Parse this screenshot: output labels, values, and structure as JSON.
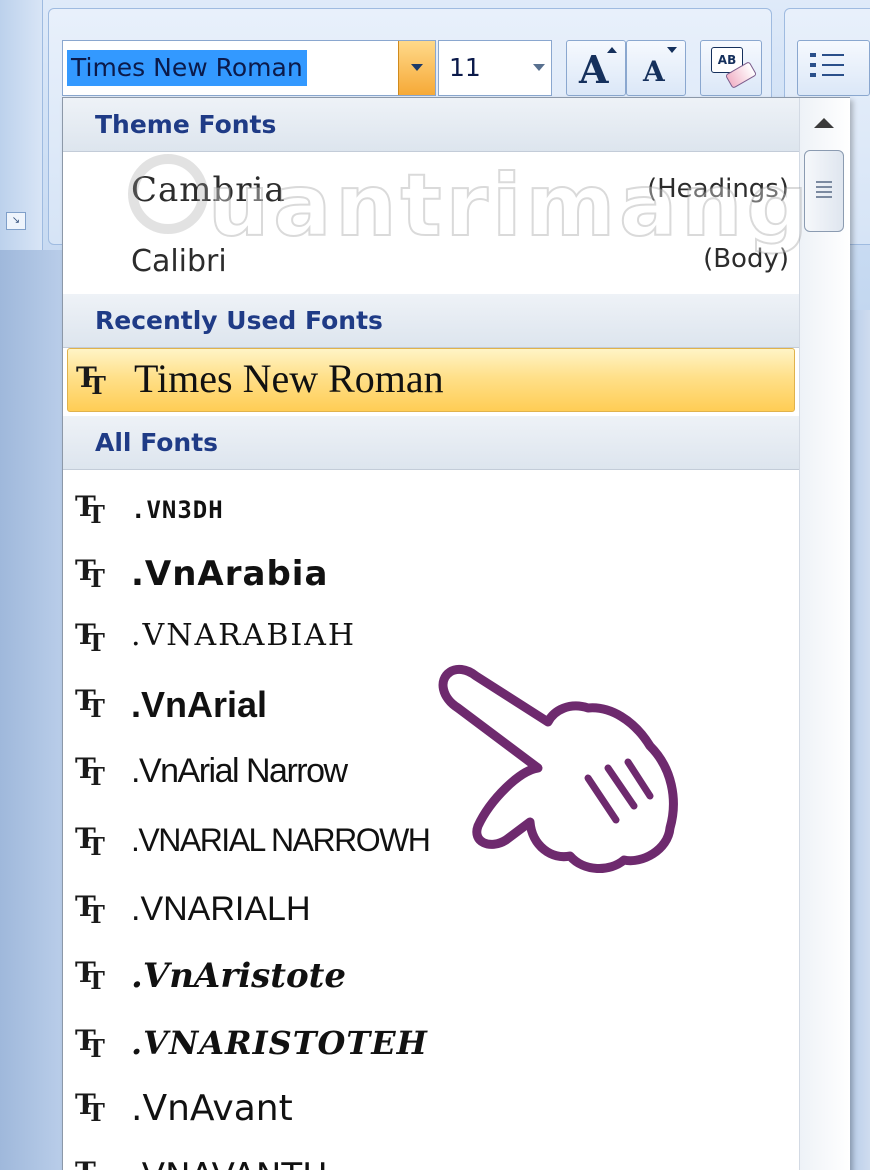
{
  "ribbon": {
    "font_name_value": "Times New Roman",
    "font_size_value": "11",
    "grow_font_glyph": "A",
    "shrink_font_glyph": "A",
    "clear_format_glyph": "AB"
  },
  "dropdown": {
    "theme_header": "Theme Fonts",
    "theme_fonts": [
      {
        "name": "Cambria",
        "role": "(Headings)"
      },
      {
        "name": "Calibri",
        "role": "(Body)"
      }
    ],
    "recent_header": "Recently Used Fonts",
    "recent_fonts": [
      {
        "name": "Times New Roman"
      }
    ],
    "all_header": "All Fonts",
    "all_fonts": [
      {
        "name": ".VN3DH"
      },
      {
        "name": ".VnArabia"
      },
      {
        "name": ".VNARABIAH"
      },
      {
        "name": ".VnArial"
      },
      {
        "name": ".VnArial Narrow"
      },
      {
        "name": ".VNARIAL NARROWH"
      },
      {
        "name": ".VNARIALH"
      },
      {
        "name": ".VnAristote"
      },
      {
        "name": ".VNARISTOTEH"
      },
      {
        "name": ".VnAvant"
      },
      {
        "name": ".VNAVANTH"
      }
    ]
  },
  "icons": {
    "truetype": "truetype-font-icon",
    "scroll_up": "triangle-up-icon",
    "dropdown_arrow": "chevron-down-icon",
    "bullets": "bullet-list-icon",
    "pointer": "pointing-hand-icon"
  },
  "watermark": {
    "text": "uantrimang"
  },
  "colors": {
    "selection": "#3399ff",
    "highlight_row": "#ffcd55",
    "header_text": "#1f3b86",
    "ribbon_bg": "#d2e2f6",
    "hand_outline": "#6e2a6e"
  }
}
